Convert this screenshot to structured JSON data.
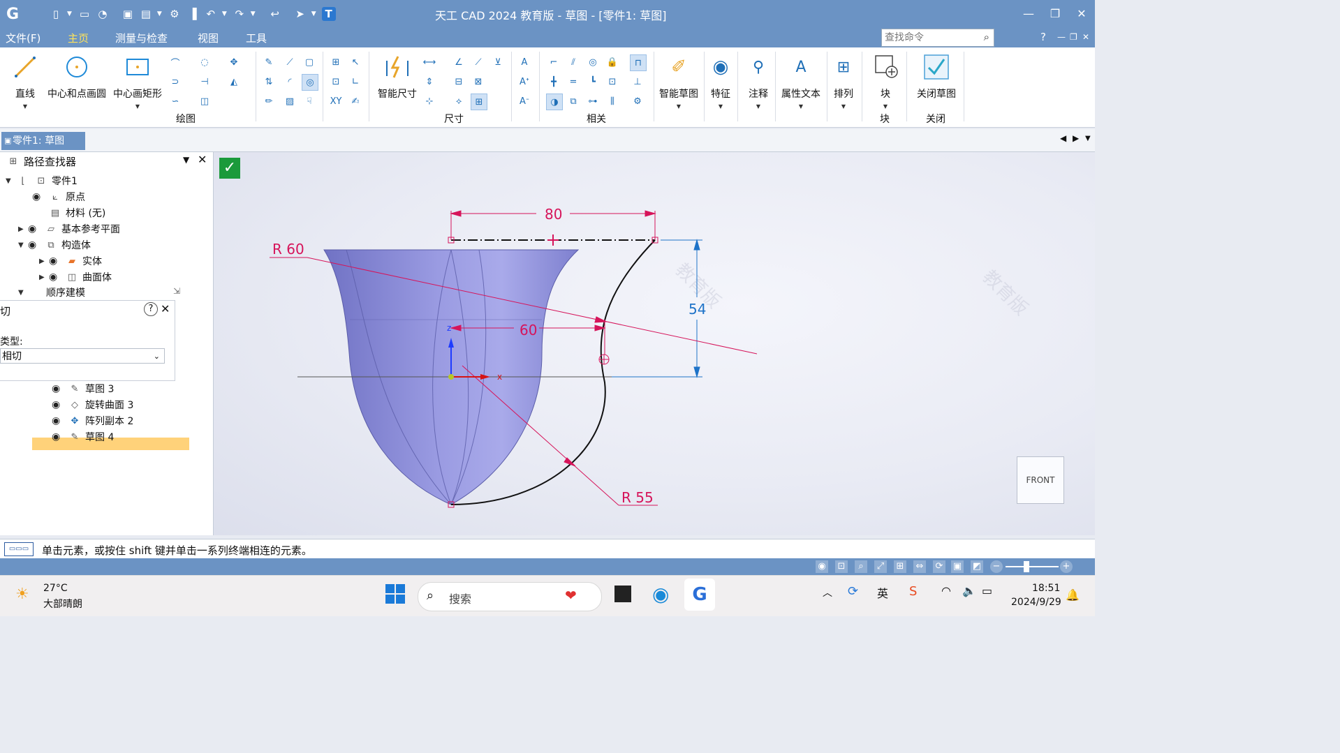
{
  "window": {
    "title": "天工 CAD 2024 教育版 - 草图 - [零件1: 草图]"
  },
  "menu": {
    "items": [
      "文件(F)",
      "主页",
      "测量与检查",
      "视图",
      "工具"
    ],
    "active": "主页"
  },
  "search": {
    "placeholder": "查找命令"
  },
  "ribbon": {
    "draw": {
      "line": "直线",
      "center_circle": "中心和点画圆",
      "center_rect": "中心画矩形",
      "group": "绘图"
    },
    "dim": {
      "smart_dim": "智能尺寸",
      "group": "尺寸"
    },
    "relate": {
      "group": "相关"
    },
    "smart_sketch": "智能草图",
    "feature": "特征",
    "annotation": "注释",
    "attr_text": "属性文本",
    "arrange": "排列",
    "block": {
      "label": "块",
      "group": "块"
    },
    "close_sketch": {
      "label": "关闭草图",
      "group": "关闭"
    }
  },
  "doc_tab": "零件1: 草图",
  "pathfinder": {
    "title": "路径查找器",
    "tree": {
      "part": "零件1",
      "origin": "原点",
      "material": "材料 (无)",
      "base_planes": "基本参考平面",
      "construction": "构造体",
      "solid": "实体",
      "surface": "曲面体",
      "sequential": "顺序建模",
      "sketch3": "草图 3",
      "revolve3": "旋转曲面 3",
      "pattern2": "阵列副本 2",
      "sketch4": "草图 4"
    },
    "cmd_panel": {
      "title": "切",
      "type_label": "类型:",
      "type_value": "相切"
    }
  },
  "viewport": {
    "dims": {
      "top_width": "80",
      "right_height": "54",
      "inner_width": "60",
      "radius_top": "R 60",
      "radius_bottom": "R 55"
    },
    "axis_z": "z",
    "axis_x": "x",
    "view_cube": "FRONT",
    "watermark": "教育版"
  },
  "prompt": "单击元素，或按住 shift 键并单击一系列终端相连的元素。",
  "taskbar": {
    "weather_temp": "27°C",
    "weather_desc": "大部晴朗",
    "search": "搜索",
    "ime": "英",
    "time": "18:51",
    "date": "2024/9/29"
  },
  "colors": {
    "title_bar": "#6b93c4",
    "active_menu": "#ffe35a",
    "dimension_pink": "#d6145a",
    "dimension_blue": "#1e73c8",
    "surface_purple": "#8f90d8"
  }
}
